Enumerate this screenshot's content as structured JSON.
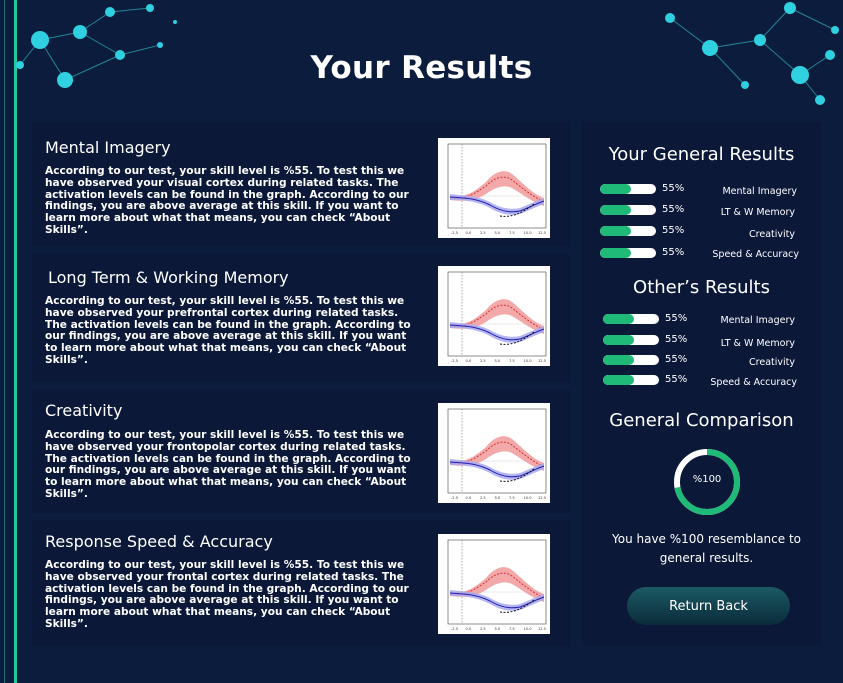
{
  "page": {
    "title": "Your Results"
  },
  "skills": [
    {
      "title": "Mental Imagery",
      "text": "According to our test, your skill level is %55. To test this we have observed your visual cortex during related tasks. The activation levels can be found in the graph. According to our findings, you are above average at this skill. If you want to learn more about what that means, you can check “About Skills”."
    },
    {
      "title": "Long Term & Working Memory",
      "text": "According to our test, your skill level is %55. To test this we have observed your prefrontal cortex during related tasks. The activation levels can be found in the graph. According to our findings, you are above average at this skill. If you want to learn more about what that means, you can check “About Skills”."
    },
    {
      "title": "Creativity",
      "text": "According to our test, your skill level is %55. To test this we have observed your frontopolar cortex during related tasks. The activation levels can be found in the graph. According to our findings, you are above average at this skill. If you want to learn more about what that means, you can check “About Skills”."
    },
    {
      "title": "Response Speed & Accuracy",
      "text": "According to our test, your skill level is %55. To test this we have observed your frontal cortex during related tasks. The activation levels can be found in the graph. According to our findings, you are above average at this skill. If you want to learn more about what that means, you can check “About Skills”."
    }
  ],
  "general_results": {
    "title": "Your General Results",
    "items": [
      {
        "label": "Mental Imagery",
        "percent_text": "55%",
        "fill": 0.55
      },
      {
        "label": "LT & W Memory",
        "percent_text": "55%",
        "fill": 0.55
      },
      {
        "label": "Creativity",
        "percent_text": "55%",
        "fill": 0.55
      },
      {
        "label": "Speed & Accuracy",
        "percent_text": "55%",
        "fill": 0.55
      }
    ]
  },
  "others_results": {
    "title": "Other’s Results",
    "items": [
      {
        "label": "Mental Imagery",
        "percent_text": "55%",
        "fill": 0.55
      },
      {
        "label": "LT & W Memory",
        "percent_text": "55%",
        "fill": 0.55
      },
      {
        "label": "Creativity",
        "percent_text": "55%",
        "fill": 0.55
      },
      {
        "label": "Speed & Accuracy",
        "percent_text": "55%",
        "fill": 0.55
      }
    ]
  },
  "comparison": {
    "title": "General Comparison",
    "donut_text": "%100",
    "donut_fill": 0.72,
    "text": "You have %100 resemblance to general results."
  },
  "return_button": {
    "label": "Return Back"
  },
  "graph_ticks": [
    "-2.5",
    "0.0",
    "2.5",
    "5.0",
    "7.5",
    "10.0",
    "12.5"
  ],
  "colors": {
    "accent": "#1fba78",
    "background": "#0c1c3c",
    "card": "#0b1838",
    "network": "#2fd0e0"
  }
}
